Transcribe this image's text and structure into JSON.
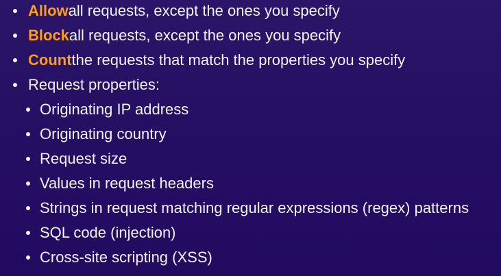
{
  "actions": [
    {
      "keyword": "Allow",
      "text": " all requests, except the ones you specify"
    },
    {
      "keyword": "Block",
      "text": " all requests, except the ones you specify"
    },
    {
      "keyword": "Count",
      "text": " the requests that match the properties you specify"
    }
  ],
  "properties": {
    "heading": "Request properties:",
    "items": [
      "Originating IP address",
      "Originating country",
      "Request size",
      "Values in request headers",
      "Strings in request matching regular expressions (regex) patterns",
      "SQL code (injection)",
      "Cross-site scripting (XSS)"
    ]
  },
  "colors": {
    "background": "#250f63",
    "text": "#f2f2f7",
    "keyword": "#ff9d18"
  }
}
